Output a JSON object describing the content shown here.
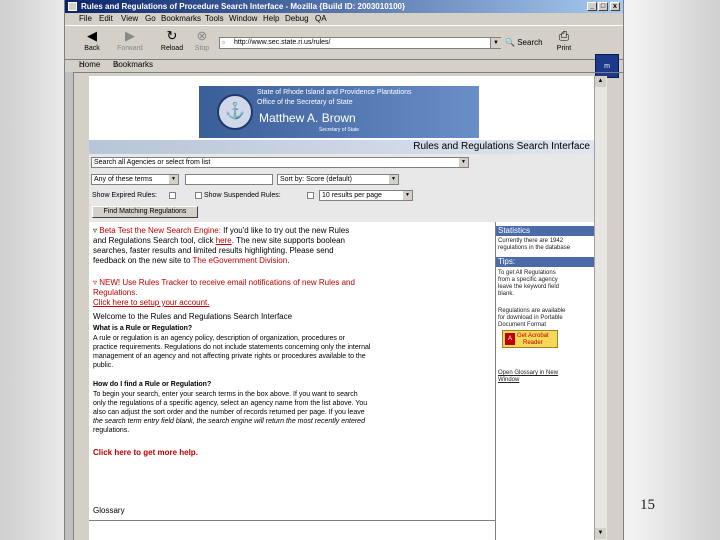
{
  "window": {
    "title": "Rules and Regulations of Procedure Search Interface - Mozilla {Build ID: 2003010100}",
    "controls": [
      "_",
      "□",
      "x"
    ]
  },
  "menu": [
    "File",
    "Edit",
    "View",
    "Go",
    "Bookmarks",
    "Tools",
    "Window",
    "Help",
    "Debug",
    "QA"
  ],
  "toolbar": {
    "back": "Back",
    "forward": "Forward",
    "reload": "Reload",
    "stop": "Stop",
    "url": "http://www.sec.state.ri.us/rules/",
    "search": "Search",
    "print": "Print"
  },
  "personal_bar": {
    "home": "Home",
    "bookmarks": "Bookmarks"
  },
  "banner": {
    "line1": "State of Rhode Island and Providence Plantations",
    "line2": "Office of the Secretary of State",
    "name": "Matthew A. Brown",
    "role": "Secretary of State"
  },
  "header": {
    "title": "Rules and Regulations Search Interface"
  },
  "form": {
    "agency_select": "Search all Agencies or select from list",
    "terms_select": "Any of these terms",
    "sort_select": "Sort by: Score (default)",
    "show_expired": "Show Expired Rules:",
    "show_suspended": "Show Suspended Rules:",
    "per_page": "10 results per page",
    "find_button": "Find Matching Regulations"
  },
  "main": {
    "beta_title": "Beta Test the New Search Engine:",
    "beta_line1_rest": " If you'd like to try out the new Rules",
    "beta_line2": "and Regulations Search tool, click ",
    "beta_link": "here",
    "beta_line2_rest": ". The new site supports boolean",
    "beta_line3": "searches, faster results and limited results highlighting. Please send",
    "beta_line4": "feedback on the new site to ",
    "beta_div": "The eGovernment Division",
    "new_line1": "NEW! Use Rules Tracker to receive email notifications of new Rules and",
    "new_line2": "Regulations.",
    "new_line3": "Click here to setup your account.",
    "welcome": "Welcome to the Rules and Regulations Search Interface",
    "what_q": "What is a Rule or Regulation?",
    "what_1": "A rule or regulation is an agency policy, description of organization, procedures or",
    "what_2": "practice requirements. Regulations do not include statements concerning only the internal",
    "what_3": "management of an agency and not affecting private rights or procedures available to the",
    "what_4": "public.",
    "how_q": "How do I find a Rule or Regulation?",
    "how_1": "To begin your search, enter your search terms in the box above. If you want to search",
    "how_2": "only the regulations of a specific agency, select an agency name from the list above. You",
    "how_3": "also can adjust the sort order and the number of records returned per page. If you leave",
    "how_4": "the search term entry field blank, the search engine will return the most recently entered",
    "how_5": "regulations.",
    "help_link": "Click here to get more help.",
    "glossary": "Glossary"
  },
  "right": {
    "stats_head": "Statistics",
    "stats_1": "Currently there are 1942",
    "stats_2": "regulations in the database",
    "tips_head": "Tips:",
    "tips_1": "To get All Regulations",
    "tips_2": "from a specific agency",
    "tips_3": "leave the keyword field",
    "tips_4": "blank.",
    "pdf_1": "Regulations are available",
    "pdf_2": "for download in Portable",
    "pdf_3": "Document Format",
    "acrobat_1": "Get Acrobat",
    "acrobat_2": "Reader",
    "gloss_1": "Open Glossary in New",
    "gloss_2": "Window"
  },
  "slide": {
    "page_number": "15"
  }
}
